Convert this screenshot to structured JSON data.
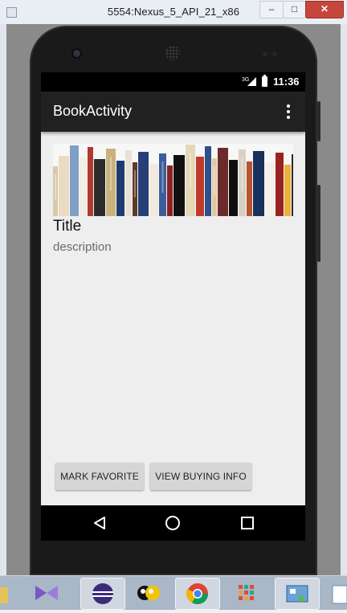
{
  "window": {
    "title": "5554:Nexus_5_API_21_x86",
    "minimize_label": "–",
    "maximize_label": "□",
    "close_label": "✕"
  },
  "status_bar": {
    "network": "3G",
    "time": "11:36"
  },
  "app_bar": {
    "title": "BookActivity",
    "overflow_icon": "more-vert-icon"
  },
  "content": {
    "image_description": "book-spines-image",
    "title": "Title",
    "description": "description"
  },
  "buttons": {
    "mark_favorite": "MARK FAVORITE",
    "view_buying_info": "VIEW BUYING INFO"
  },
  "nav_bar": {
    "back_icon": "back-triangle-icon",
    "home_icon": "home-circle-icon",
    "recent_icon": "recent-apps-square-icon"
  },
  "taskbar": {
    "apps": [
      "file-explorer-icon",
      "visual-studio-icon",
      "eclipse-icon",
      "genymotion-bee-icon",
      "chrome-icon",
      "app-grid-icon",
      "control-panel-icon",
      "notepad-icon"
    ]
  }
}
